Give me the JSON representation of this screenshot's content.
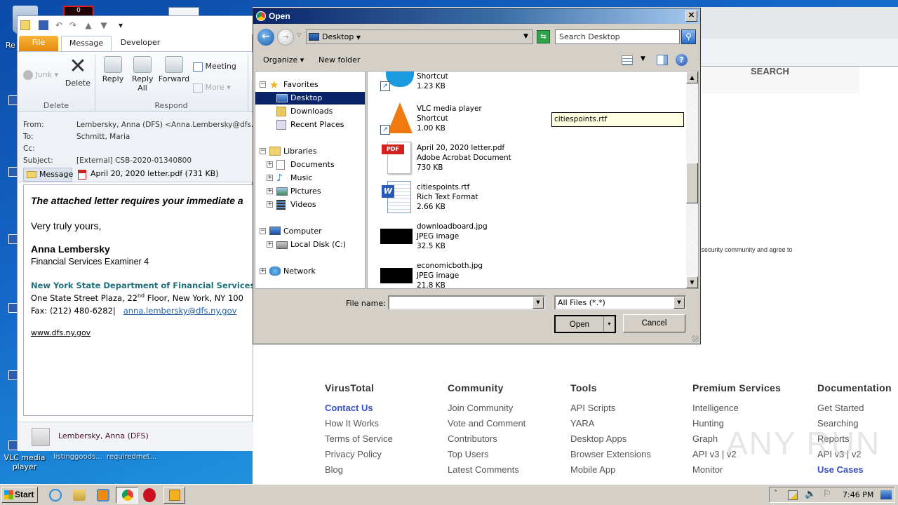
{
  "desktop": {
    "icons": [
      {
        "label": "Re"
      },
      {
        "label": "VLC media player"
      },
      {
        "label": "listinggoods..."
      },
      {
        "label": "requiredmet..."
      }
    ],
    "counter_badge": "0"
  },
  "outlook": {
    "tabs": {
      "file": "File",
      "message": "Message",
      "developer": "Developer"
    },
    "ribbon": {
      "junk": "Junk",
      "delete": "Delete",
      "reply": "Reply",
      "reply_all": "Reply All",
      "forward": "Forward",
      "meeting": "Meeting",
      "more": "More",
      "group_delete": "Delete",
      "group_respond": "Respond"
    },
    "header": {
      "from_label": "From:",
      "from_value": "Lembersky, Anna (DFS) <Anna.Lembersky@dfs.ny.",
      "to_label": "To:",
      "to_value": "Schmitt, Maria",
      "cc_label": "Cc:",
      "cc_value": "",
      "subject_label": "Subject:",
      "subject_value": "[External] CSB-2020-01340800"
    },
    "attachments": {
      "message_tab": "Message",
      "file": "April 20, 2020 letter.pdf (731 KB)"
    },
    "body": {
      "line1": "The attached letter requires your immediate a",
      "closing": "Very truly yours,",
      "name": "Anna Lembersky",
      "title": "Financial Services Examiner 4",
      "org": "New York State Department of Financial Services",
      "address_pre": "One State Street Plaza, 22",
      "address_sup": "nd",
      "address_post": " Floor, New York, NY 100",
      "fax": "Fax: (212) 480-6282|",
      "email": "anna.lembersky@dfs.ny.gov",
      "website": "www.dfs.ny.gov"
    },
    "people_pane": "Lembersky, Anna (DFS)"
  },
  "browser": {
    "search_heading": "SEARCH",
    "agree_text": "e security community and agree to",
    "footer": [
      {
        "heading": "VirusTotal",
        "links": [
          "Contact Us",
          "How It Works",
          "Terms of Service",
          "Privacy Policy",
          "Blog"
        ],
        "highlight": 0
      },
      {
        "heading": "Community",
        "links": [
          "Join Community",
          "Vote and Comment",
          "Contributors",
          "Top Users",
          "Latest Comments"
        ],
        "highlight": -1
      },
      {
        "heading": "Tools",
        "links": [
          "API Scripts",
          "YARA",
          "Desktop Apps",
          "Browser Extensions",
          "Mobile App"
        ],
        "highlight": -1
      },
      {
        "heading": "Premium Services",
        "links": [
          "Intelligence",
          "Hunting",
          "Graph",
          "API v3 | v2",
          "Monitor"
        ],
        "highlight": -1
      },
      {
        "heading": "Documentation",
        "links": [
          "Get Started",
          "Searching",
          "Reports",
          "API v3 | v2",
          "Use Cases"
        ],
        "highlight": 4
      }
    ]
  },
  "dialog": {
    "title": "Open",
    "address": "Desktop",
    "search_placeholder": "Search Desktop",
    "organize": "Organize",
    "new_folder": "New folder",
    "tree": {
      "favorites": "Favorites",
      "desktop": "Desktop",
      "downloads": "Downloads",
      "recent": "Recent Places",
      "libraries": "Libraries",
      "documents": "Documents",
      "music": "Music",
      "pictures": "Pictures",
      "videos": "Videos",
      "computer": "Computer",
      "local_disk": "Local Disk (C:)",
      "network": "Network"
    },
    "files": [
      {
        "name": "",
        "type": "Shortcut",
        "size": "1.23 KB",
        "icon": "skype-shortcut-icon"
      },
      {
        "name": "VLC media player",
        "type": "Shortcut",
        "size": "1.00 KB",
        "icon": "vlc-icon"
      },
      {
        "name": "April 20, 2020 letter.pdf",
        "type": "Adobe Acrobat Document",
        "size": "730 KB",
        "icon": "pdf-icon"
      },
      {
        "name": "citiespoints.rtf",
        "type": "Rich Text Format",
        "size": "2.66 KB",
        "icon": "word-doc-icon"
      },
      {
        "name": "downloadboard.jpg",
        "type": "JPEG image",
        "size": "32.5 KB",
        "icon": "jpeg-thumbnail"
      },
      {
        "name": "economicboth.jpg",
        "type": "JPEG image",
        "size": "21.8 KB",
        "icon": "jpeg-thumbnail"
      }
    ],
    "tooltip": "citiespoints.rtf",
    "file_name_label": "File name:",
    "file_name_value": "",
    "filter": "All Files (*.*)",
    "open": "Open",
    "cancel": "Cancel"
  },
  "taskbar": {
    "start": "Start",
    "clock": "7:46 PM"
  },
  "watermark": "ANY RUN"
}
